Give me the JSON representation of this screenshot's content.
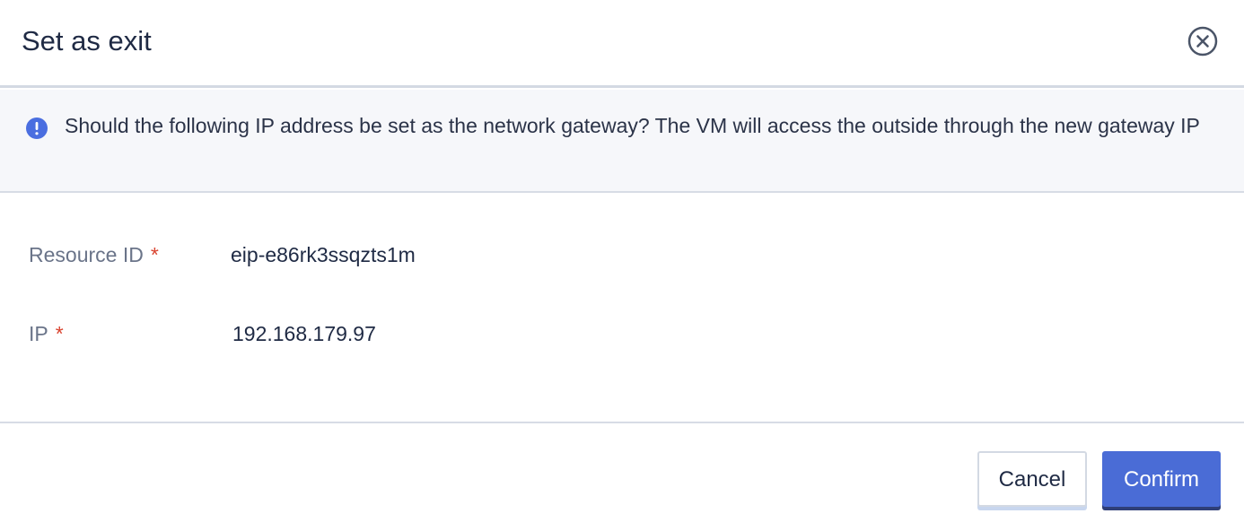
{
  "dialog": {
    "title": "Set as exit"
  },
  "notice": {
    "icon": "info-exclamation-icon",
    "text": "Should the following IP address be set as the network gateway? The VM will access the outside through the new gateway IP"
  },
  "form": {
    "fields": [
      {
        "label": "Resource ID",
        "required_mark": "*",
        "value": "eip-e86rk3ssqzts1m"
      },
      {
        "label": "IP",
        "required_mark": "*",
        "value": "192.168.179.97"
      }
    ]
  },
  "footer": {
    "cancel_label": "Cancel",
    "confirm_label": "Confirm"
  },
  "colors": {
    "primary": "#4a6cd6",
    "info_icon": "#4a6ee0",
    "required": "#d9432f",
    "notice_bg": "#f6f7fa"
  }
}
